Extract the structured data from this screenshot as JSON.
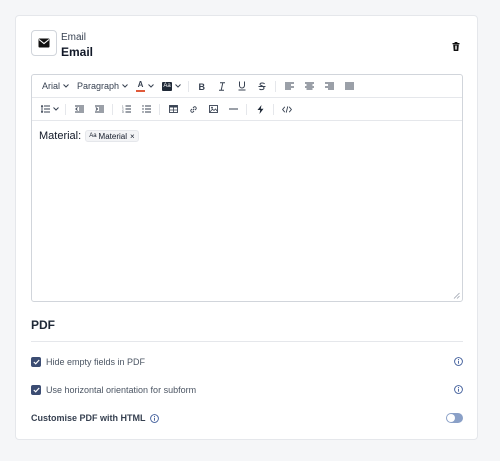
{
  "email": {
    "subtitle": "Email",
    "title": "Email",
    "icon": "envelope-icon",
    "delete_icon": "trash-icon"
  },
  "toolbar": {
    "font_family": "Arial",
    "block_format": "Paragraph",
    "text_color_label": "A",
    "highlight_label": "Aa"
  },
  "editor": {
    "content_label": "Material:",
    "chip_prefix": "Aa",
    "chip_label": "Material",
    "chip_remove": "×"
  },
  "pdf": {
    "title": "PDF",
    "options": [
      {
        "label": "Hide empty fields in PDF",
        "checked": true
      },
      {
        "label": "Use horizontal orientation for subform",
        "checked": true
      }
    ],
    "customise_label": "Customise PDF with HTML",
    "customise_enabled": false
  },
  "colors": {
    "accent": "#3b4c72",
    "info": "#3b5998",
    "toggle": "#8aa0c7",
    "text_color_swatch": "#e05a3a"
  }
}
